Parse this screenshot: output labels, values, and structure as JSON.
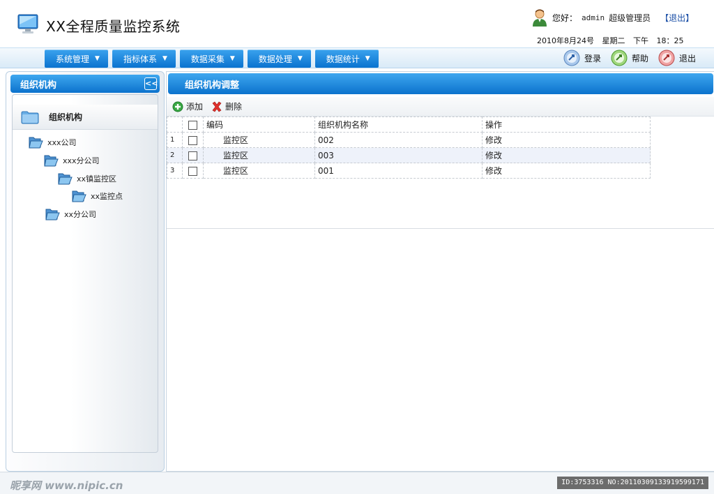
{
  "header": {
    "app_title": "XX全程质量监控系统",
    "greeting": "您好：",
    "username": "admin",
    "role": "超级管理员",
    "logout_link": "【退出】",
    "datetime": "2010年8月24号 星期二 下午 18：25"
  },
  "nav": {
    "menu": [
      {
        "label": "系统管理"
      },
      {
        "label": "指标体系"
      },
      {
        "label": "数据采集"
      },
      {
        "label": "数据处理"
      },
      {
        "label": "数据统计"
      }
    ],
    "quick": {
      "login": "登录",
      "help": "帮助",
      "exit": "退出"
    }
  },
  "left": {
    "title": "组织机构",
    "collapse_glyph": "<<",
    "tree_title": "组织机构",
    "tree": [
      {
        "label": "xxx公司"
      },
      {
        "label": "xxx分公司"
      },
      {
        "label": "xx镇监控区"
      },
      {
        "label": "xx监控点"
      },
      {
        "label": "xx分公司"
      }
    ]
  },
  "main": {
    "title": "组织机构调整",
    "toolbar": {
      "add": "添加",
      "delete": "删除"
    },
    "table": {
      "headers": [
        "编码",
        "组织机构名称",
        "操作"
      ],
      "rows": [
        {
          "num": "1",
          "code": "监控区",
          "name": "002",
          "action": "修改"
        },
        {
          "num": "2",
          "code": "监控区",
          "name": "003",
          "action": "修改"
        },
        {
          "num": "3",
          "code": "监控区",
          "name": "001",
          "action": "修改"
        }
      ]
    }
  },
  "footer": {
    "watermark": "昵享网 www.nipic.cn",
    "id_text": "ID:3753316 NO:20110309133919599171"
  },
  "colors": {
    "accent_blue": "#0b72cd",
    "link_blue": "#1b4fa6",
    "row_alt": "#eef2fa"
  }
}
